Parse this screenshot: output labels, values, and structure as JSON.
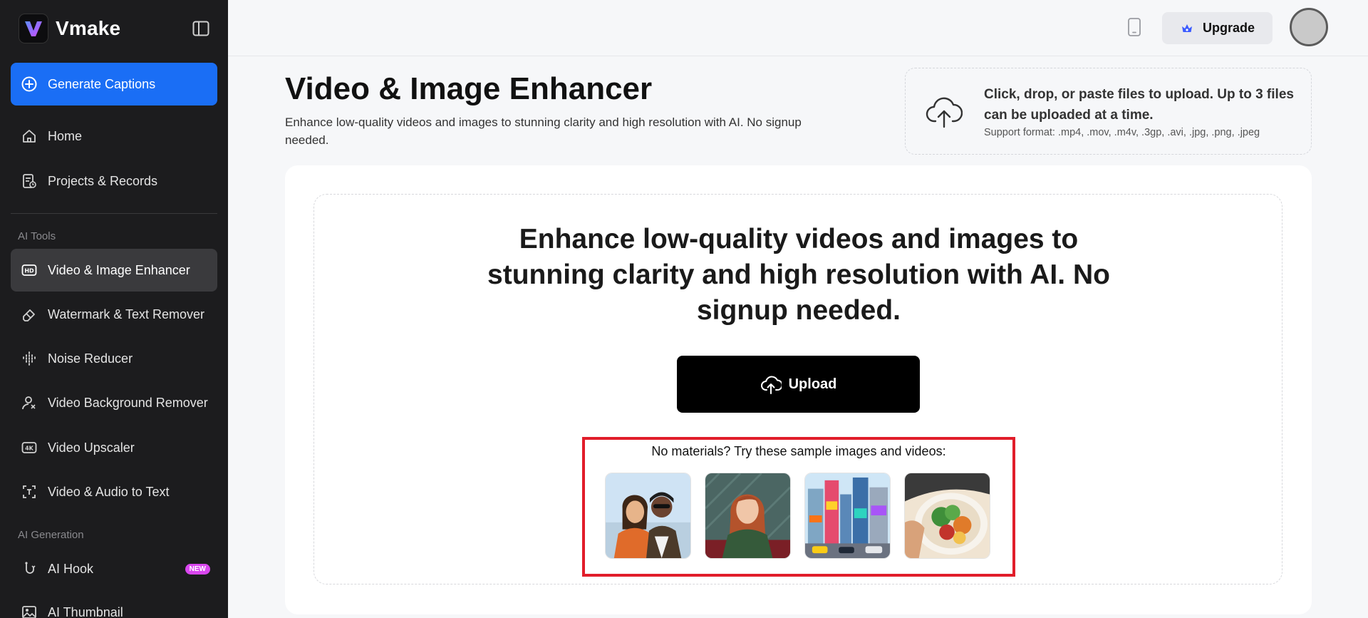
{
  "app": {
    "name": "Vmake"
  },
  "sidebar": {
    "generate_button": "Generate Captions",
    "items_top": [
      {
        "label": "Home"
      },
      {
        "label": "Projects & Records"
      }
    ],
    "section_ai_tools": "AI Tools",
    "ai_tools": [
      {
        "label": "Video & Image Enhancer",
        "active": true
      },
      {
        "label": "Watermark & Text Remover"
      },
      {
        "label": "Noise Reducer"
      },
      {
        "label": "Video Background Remover"
      },
      {
        "label": "Video Upscaler"
      },
      {
        "label": "Video & Audio to Text"
      }
    ],
    "section_ai_generation": "AI Generation",
    "ai_generation": [
      {
        "label": "AI Hook",
        "badge": "NEW"
      },
      {
        "label": "AI Thumbnail"
      }
    ]
  },
  "topbar": {
    "upgrade_label": "Upgrade"
  },
  "header": {
    "title": "Video & Image Enhancer",
    "subtitle": "Enhance low-quality videos and images to stunning clarity and high resolution with AI. No signup needed."
  },
  "upload_hint": {
    "main": "Click, drop, or paste files to upload. Up to 3 files can be uploaded at a time.",
    "formats": "Support format: .mp4, .mov, .m4v, .3gp, .avi, .jpg, .png, .jpeg"
  },
  "main": {
    "heading": "Enhance low-quality videos and images to stunning clarity and high resolution with AI. No signup needed.",
    "upload_label": "Upload",
    "samples_label": "No materials? Try these sample images and videos:"
  },
  "colors": {
    "accent": "#1a6ef5",
    "highlight": "#e11d2a",
    "sidebar_bg": "#1c1c1e"
  }
}
